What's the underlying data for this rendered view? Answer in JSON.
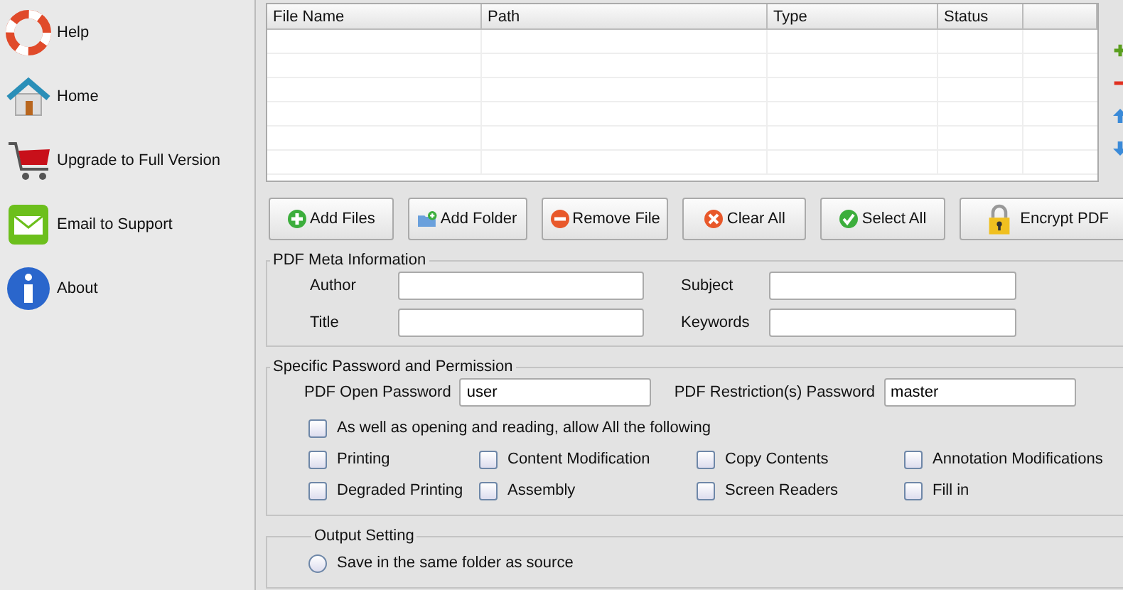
{
  "sidebar": {
    "items": [
      {
        "label": "Help",
        "kind": "help"
      },
      {
        "label": "Home",
        "kind": "home"
      },
      {
        "label": "Upgrade to Full Version",
        "kind": "cart"
      },
      {
        "label": "Email to Support",
        "kind": "email"
      },
      {
        "label": "About",
        "kind": "about"
      }
    ]
  },
  "table": {
    "columns": [
      "File Name",
      "Path",
      "Type",
      "Status"
    ]
  },
  "buttons": [
    {
      "label": "Add Files",
      "kind": "add"
    },
    {
      "label": "Add Folder",
      "kind": "folder"
    },
    {
      "label": "Remove File",
      "kind": "remove"
    },
    {
      "label": "Clear All",
      "kind": "clear"
    },
    {
      "label": "Select All",
      "kind": "select"
    },
    {
      "label": "Encrypt PDF",
      "kind": "encrypt"
    }
  ],
  "meta": {
    "title": "PDF Meta Information",
    "fields": [
      {
        "label": "Author"
      },
      {
        "label": "Subject"
      },
      {
        "label": "Title"
      },
      {
        "label": "Keywords"
      }
    ]
  },
  "permissions": {
    "title": "Specific Password and Permission",
    "open_password": {
      "label": "PDF Open Password",
      "value": "user"
    },
    "restriction_password": {
      "label": "PDF Restriction(s) Password",
      "value": "master"
    },
    "allow_all": {
      "label": "As well as opening and reading, allow All the following",
      "checked": false
    },
    "options": [
      {
        "label": "Printing",
        "checked": false
      },
      {
        "label": "Content Modification",
        "checked": false
      },
      {
        "label": "Copy Contents",
        "checked": false
      },
      {
        "label": "Annotation Modifications",
        "checked": false
      },
      {
        "label": "Degraded Printing",
        "checked": false
      },
      {
        "label": "Assembly",
        "checked": false
      },
      {
        "label": "Screen Readers",
        "checked": false
      },
      {
        "label": "Fill in",
        "checked": false
      }
    ]
  },
  "output": {
    "title": "Output Setting",
    "options": [
      {
        "label": "Save in the same folder as source",
        "selected": false
      }
    ]
  }
}
